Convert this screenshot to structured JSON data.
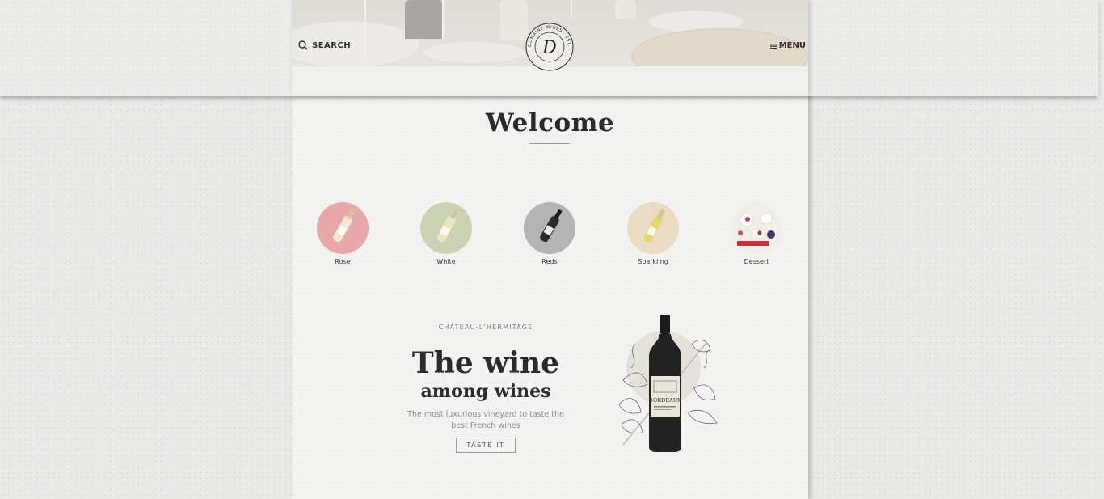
{
  "header": {
    "search_label": "SEARCH",
    "menu_label": "MENU",
    "logo": {
      "monogram": "D",
      "ring_text": "DOMAINE WINES · EST. · "
    }
  },
  "main": {
    "welcome_title": "Welcome",
    "categories": [
      {
        "label": "Rose",
        "color": "#e8a7a9"
      },
      {
        "label": "White",
        "color": "#c9d3b4"
      },
      {
        "label": "Reds",
        "color": "#b4b4b4"
      },
      {
        "label": "Sparkling",
        "color": "#eadbc4"
      },
      {
        "label": "Dessert",
        "color": "#f1eeea"
      }
    ],
    "promo": {
      "eyebrow": "CHÂTEAU-L'HERMITAGE",
      "headline": "The wine",
      "subheadline": "among wines",
      "description": "The most luxurious vineyard to taste the best French wines",
      "cta_label": "TASTE IT",
      "bottle_label": "BORDEAUX"
    }
  },
  "colors": {
    "page_bg": "#e9e9e7",
    "column_bg": "#f3f3f1",
    "text_dark": "#2b2b2b",
    "text_muted": "#8b8b8b"
  }
}
